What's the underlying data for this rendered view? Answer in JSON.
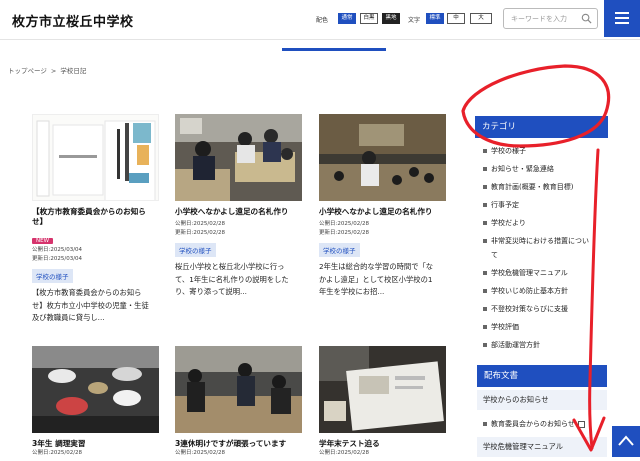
{
  "header": {
    "site_title": "枚方市立桜丘中学校",
    "color_label": "配色",
    "color_options": [
      "通常",
      "白黒",
      "黒地"
    ],
    "text_label": "文字",
    "text_options": [
      "標準",
      "中",
      "大"
    ],
    "search_placeholder": "キーワードを入力"
  },
  "breadcrumb": [
    "トップページ",
    ">",
    "学校日記"
  ],
  "cards": [
    {
      "title_1": "【枚方市教育委員会からのお知ら",
      "title_2": "せ】",
      "badge": "NEW",
      "published": "公開日:2025/03/04",
      "updated": "更新日:2025/03/04",
      "category": "学校の様子",
      "excerpt_1": "【枚方市教育委員会からのお知ら",
      "excerpt_2": "せ】枚方市立小中学校の児童・生徒",
      "excerpt_3": "及び教職員に貸与し..."
    },
    {
      "title_1": "小学校へなかよし遠足の名札作り",
      "published": "公開日:2025/02/28",
      "updated": "更新日:2025/02/28",
      "category": "学校の様子",
      "excerpt_1": "桜丘小学校と桜丘北小学校に行っ",
      "excerpt_2": "て、1年生に名札作りの説明をした",
      "excerpt_3": "り、寄り添って説明..."
    },
    {
      "title_1": "小学校へなかよし遠足の名札作り",
      "published": "公開日:2025/02/28",
      "updated": "更新日:2025/02/28",
      "category": "学校の様子",
      "excerpt_1": "2年生は総合的な学習の時間で「な",
      "excerpt_2": "かよし遠足」として校区小学校の1",
      "excerpt_3": "年生を学校にお招..."
    },
    {
      "title_1": "3年生 調理実習",
      "published": "公開日:2025/02/28"
    },
    {
      "title_1": "3連休明けですが頑張っています",
      "published": "公開日:2025/02/28"
    },
    {
      "title_1": "学年末テスト迫る",
      "published": "公開日:2025/02/28"
    }
  ],
  "sidebar": {
    "category_heading": "カテゴリ",
    "categories": [
      "学校の様子",
      "お知らせ・緊急連絡",
      "教育計画(概要・教育目標)",
      "行事予定",
      "学校だより",
      "非常変災時における措置につい",
      "て",
      "学校危機管理マニュアル",
      "学校いじめ防止基本方針",
      "不登校対策ならびに支援",
      "学校評価",
      "部活動運営方針"
    ],
    "docs_heading": "配布文書",
    "docs": [
      "学校からのお知らせ",
      "教育委員会からのお知らせ",
      "学校危機管理マニュアル"
    ]
  },
  "colors": {
    "brand_blue": "#1f4fbf",
    "annotation_red": "#e8202a",
    "new_badge": "#d6336c"
  }
}
